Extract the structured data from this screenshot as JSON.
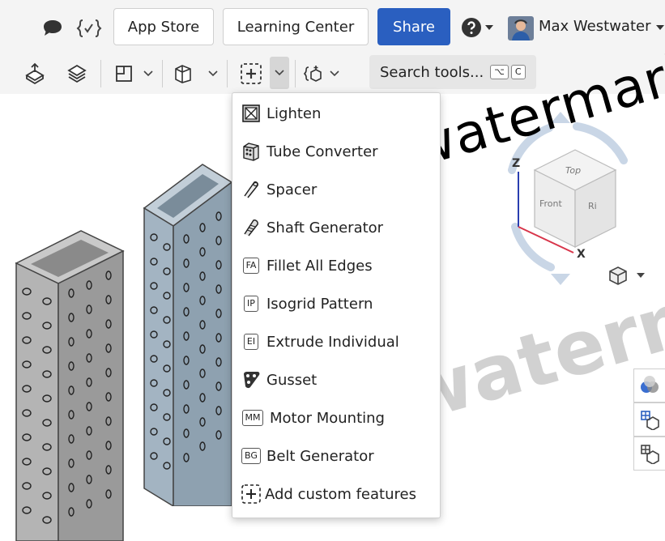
{
  "header": {
    "app_store_label": "App Store",
    "learning_center_label": "Learning Center",
    "share_label": "Share",
    "user_name": "Max Westwater"
  },
  "toolbar": {
    "search_label": "Search tools...",
    "search_shortcut": [
      "⌥",
      "C"
    ]
  },
  "menu": {
    "items": [
      {
        "label": "Lighten",
        "icon": "lighten-icon"
      },
      {
        "label": "Tube Converter",
        "icon": "tube-converter-icon"
      },
      {
        "label": "Spacer",
        "icon": "spacer-icon"
      },
      {
        "label": "Shaft Generator",
        "icon": "shaft-generator-icon"
      },
      {
        "label": "Fillet All Edges",
        "badge": "FA"
      },
      {
        "label": "Isogrid Pattern",
        "badge": "IP"
      },
      {
        "label": "Extrude Individual",
        "badge": "EI"
      },
      {
        "label": "Gusset",
        "icon": "gusset-icon"
      },
      {
        "label": "Motor Mounting",
        "badge": "MM"
      },
      {
        "label": "Belt Generator",
        "badge": "BG"
      },
      {
        "label": "Add custom features",
        "icon": "add-custom-icon"
      }
    ]
  },
  "viewcube": {
    "top": "Top",
    "front": "Front",
    "right": "Ri",
    "axis_z": "Z",
    "axis_x": "X"
  },
  "watermarks": [
    "watermark",
    "watermark"
  ],
  "colors": {
    "accent": "#2a5fc0",
    "tube_left": "#a8a8a8",
    "tube_right": "#8aa0b0"
  }
}
